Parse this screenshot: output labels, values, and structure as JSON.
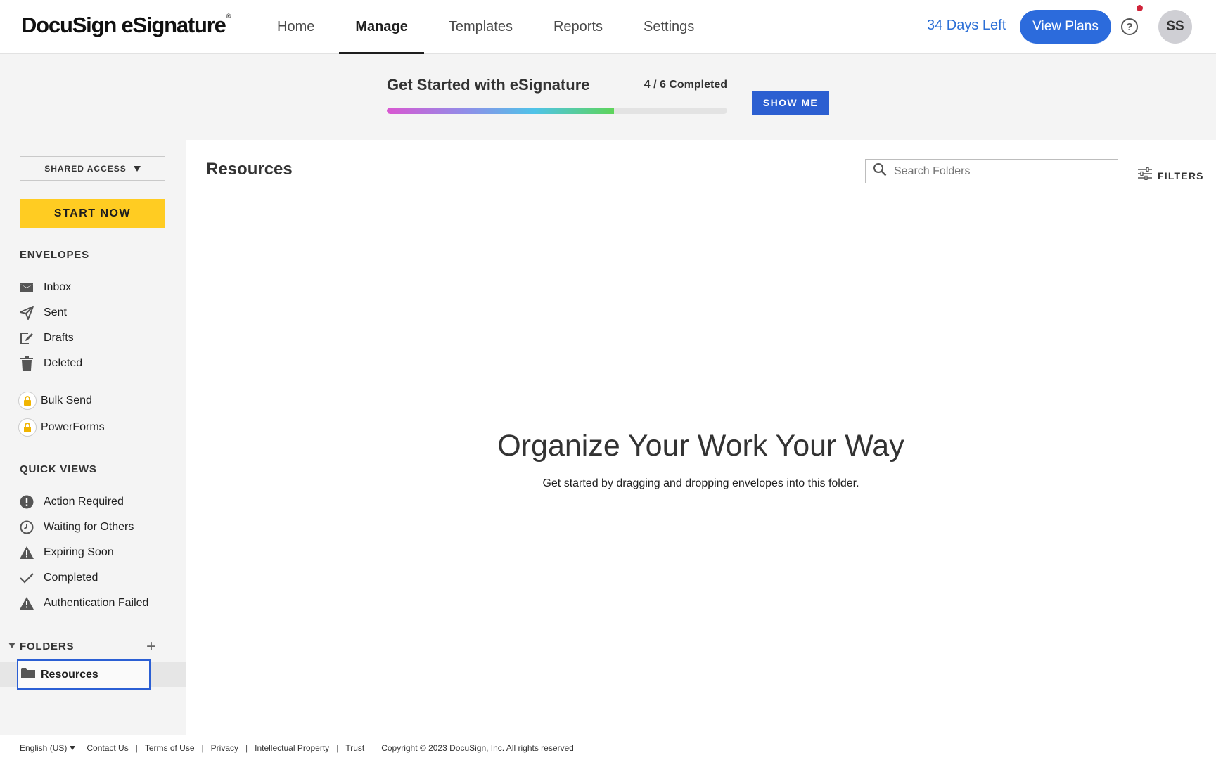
{
  "app": {
    "logo_text": "DocuSign eSignature",
    "trademark": "®"
  },
  "nav": {
    "tabs": [
      {
        "label": "Home",
        "active": false
      },
      {
        "label": "Manage",
        "active": true
      },
      {
        "label": "Templates",
        "active": false
      },
      {
        "label": "Reports",
        "active": false
      },
      {
        "label": "Settings",
        "active": false
      }
    ],
    "days_left": "34 Days Left",
    "view_plans": "View Plans",
    "help_symbol": "?",
    "avatar_initials": "SS"
  },
  "get_started": {
    "title": "Get Started with eSignature",
    "count": "4 / 6 Completed",
    "progress_fraction": 0.667,
    "show_me": "SHOW ME"
  },
  "sidebar": {
    "shared_access": "SHARED ACCESS",
    "start_now": "START NOW",
    "envelopes_label": "ENVELOPES",
    "envelopes": [
      {
        "label": "Inbox",
        "icon": "inbox-icon"
      },
      {
        "label": "Sent",
        "icon": "paper-plane-icon"
      },
      {
        "label": "Drafts",
        "icon": "edit-icon"
      },
      {
        "label": "Deleted",
        "icon": "trash-icon"
      }
    ],
    "locked": [
      {
        "label": "Bulk Send",
        "icon": "lock-icon"
      },
      {
        "label": "PowerForms",
        "icon": "lock-icon"
      }
    ],
    "quick_views_label": "QUICK VIEWS",
    "quick_views": [
      {
        "label": "Action Required",
        "icon": "exclamation-circle-icon"
      },
      {
        "label": "Waiting for Others",
        "icon": "clock-icon"
      },
      {
        "label": "Expiring Soon",
        "icon": "warning-triangle-icon"
      },
      {
        "label": "Completed",
        "icon": "checkmark-icon"
      },
      {
        "label": "Authentication Failed",
        "icon": "warning-triangle-icon"
      }
    ],
    "folders_label": "FOLDERS",
    "folders": [
      {
        "label": "Resources",
        "icon": "folder-icon",
        "selected": true
      }
    ]
  },
  "main": {
    "title": "Resources",
    "search_placeholder": "Search Folders",
    "filters": "FILTERS",
    "empty_title": "Organize Your Work Your Way",
    "empty_subtitle": "Get started by dragging and dropping envelopes into this folder."
  },
  "footer": {
    "language": "English (US)",
    "links": [
      "Contact Us",
      "Terms of Use",
      "Privacy",
      "Intellectual Property",
      "Trust"
    ],
    "copyright": "Copyright © 2023 DocuSign, Inc. All rights reserved"
  },
  "colors": {
    "accent_blue": "#2c6bdc",
    "start_yellow": "#ffcc22",
    "notification_red": "#d0243a",
    "sidebar_bg": "#f4f4f4"
  }
}
